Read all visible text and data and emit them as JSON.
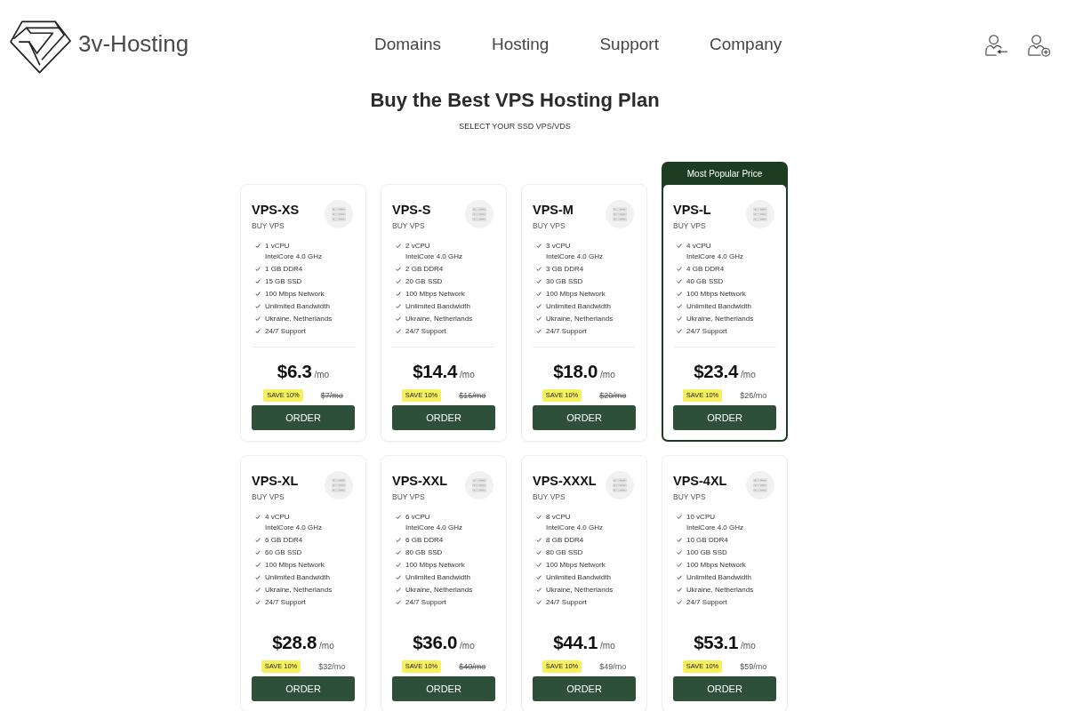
{
  "header": {
    "logo_text": "3v-Hosting",
    "nav": [
      "Domains",
      "Hosting",
      "Support",
      "Company"
    ]
  },
  "hero": {
    "title": "Buy the Best VPS Hosting Plan",
    "subtitle": "SELECT YOUR SSD VPS/VDS"
  },
  "plan_rows": [
    {
      "plans": [
        {
          "name": "VPS-XS",
          "subtitle": "BUY VPS",
          "popular": false,
          "features": [
            {
              "text": "1 vCPU",
              "detail": "IntelCore 4.0 GHz"
            },
            {
              "text": "1 GB DDR4"
            },
            {
              "text": "15 GB SSD"
            },
            {
              "text": "100 Mbps Network"
            },
            {
              "text": "Unlimited Bandwidth"
            },
            {
              "text": "Ukraine, Netherlands"
            },
            {
              "text": "24/7 Support"
            }
          ],
          "divider": true,
          "price": "$6.3",
          "period": "/mo",
          "badge": "SAVE 10%",
          "old_price": "$7/mo",
          "old_price_struck": true,
          "button": "ORDER"
        },
        {
          "name": "VPS-S",
          "subtitle": "BUY VPS",
          "popular": false,
          "features": [
            {
              "text": "2 vCPU",
              "detail": "IntelCore 4.0 GHz"
            },
            {
              "text": "2 GB DDR4"
            },
            {
              "text": "20 GB SSD"
            },
            {
              "text": "100 Mbps Network"
            },
            {
              "text": "Unlimited Bandwidth"
            },
            {
              "text": "Ukraine, Netherlands"
            },
            {
              "text": "24/7 Support"
            }
          ],
          "divider": true,
          "price": "$14.4",
          "period": "/mo",
          "badge": "SAVE 10%",
          "old_price": "$16/mo",
          "old_price_struck": true,
          "button": "ORDER"
        },
        {
          "name": "VPS-M",
          "subtitle": "BUY VPS",
          "popular": false,
          "features": [
            {
              "text": "3 vCPU",
              "detail": "IntelCore 4.0 GHz"
            },
            {
              "text": "3 GB DDR4"
            },
            {
              "text": "30 GB SSD"
            },
            {
              "text": "100 Mbps Network"
            },
            {
              "text": "Unlimited Bandwidth"
            },
            {
              "text": "Ukraine, Netherlands"
            },
            {
              "text": "24/7 Support"
            }
          ],
          "divider": true,
          "price": "$18.0",
          "period": "/mo",
          "badge": "SAVE 10%",
          "old_price": "$20/mo",
          "old_price_struck": true,
          "button": "ORDER"
        },
        {
          "name": "VPS-L",
          "subtitle": "BUY VPS",
          "popular": true,
          "ribbon": "Most Popular Price",
          "features": [
            {
              "text": "4 vCPU",
              "detail": "IntelCore 4.0 GHz"
            },
            {
              "text": "4 GB DDR4"
            },
            {
              "text": "40 GB SSD"
            },
            {
              "text": "100 Mbps Network"
            },
            {
              "text": "Unlimited Bandwidth"
            },
            {
              "text": "Ukraine, Netherlands"
            },
            {
              "text": "24/7 Support"
            }
          ],
          "divider": true,
          "price": "$23.4",
          "period": "/mo",
          "badge": "SAVE 10%",
          "old_price": "$26/mo",
          "old_price_struck": false,
          "button": "ORDER"
        }
      ]
    },
    {
      "plans": [
        {
          "name": "VPS-XL",
          "subtitle": "BUY VPS",
          "popular": false,
          "features": [
            {
              "text": "4 vCPU",
              "detail": "IntelCore 4.0 GHz"
            },
            {
              "text": "6 GB DDR4"
            },
            {
              "text": "60 GB SSD"
            },
            {
              "text": "100 Mbps Network"
            },
            {
              "text": "Unlimited Bandwidth"
            },
            {
              "text": "Ukraine, Netherlands"
            },
            {
              "text": "24/7 Support"
            }
          ],
          "divider": false,
          "price": "$28.8",
          "period": "/mo",
          "badge": "SAVE 10%",
          "old_price": "$32/mo",
          "old_price_struck": false,
          "button": "ORDER"
        },
        {
          "name": "VPS-XXL",
          "subtitle": "BUY VPS",
          "popular": false,
          "features": [
            {
              "text": "6 vCPU",
              "detail": "IntelCore 4.0 GHz"
            },
            {
              "text": "6 GB DDR4"
            },
            {
              "text": "80 GB SSD"
            },
            {
              "text": "100 Mbps Network"
            },
            {
              "text": "Unlimited Bandwidth"
            },
            {
              "text": "Ukraine, Netherlands"
            },
            {
              "text": "24/7 Support"
            }
          ],
          "divider": false,
          "price": "$36.0",
          "period": "/mo",
          "badge": "SAVE 10%",
          "old_price": "$40/mo",
          "old_price_struck": true,
          "button": "ORDER"
        },
        {
          "name": "VPS-XXXL",
          "subtitle": "BUY VPS",
          "popular": false,
          "features": [
            {
              "text": "8 vCPU",
              "detail": "IntelCore 4.0 GHz"
            },
            {
              "text": "8 GB DDR4"
            },
            {
              "text": "80 GB SSD"
            },
            {
              "text": "100 Mbps Network"
            },
            {
              "text": "Unlimited Bandwidth"
            },
            {
              "text": "Ukraine, Netherlands"
            },
            {
              "text": "24/7 Support"
            }
          ],
          "divider": false,
          "price": "$44.1",
          "period": "/mo",
          "badge": "SAVE 10%",
          "old_price": "$49/mo",
          "old_price_struck": false,
          "button": "ORDER"
        },
        {
          "name": "VPS-4XL",
          "subtitle": "BUY VPS",
          "popular": false,
          "features": [
            {
              "text": "10 vCPU",
              "detail": "IntelCore 4.0 GHz"
            },
            {
              "text": "10 GB DDR4"
            },
            {
              "text": "100 GB SSD"
            },
            {
              "text": "100 Mbps Network"
            },
            {
              "text": "Unlimited Bandwidth"
            },
            {
              "text": "Ukraine, Netherlands"
            },
            {
              "text": "24/7 Support"
            }
          ],
          "divider": false,
          "price": "$53.1",
          "period": "/mo",
          "badge": "SAVE 10%",
          "old_price": "$59/mo",
          "old_price_struck": false,
          "button": "ORDER"
        }
      ]
    }
  ]
}
